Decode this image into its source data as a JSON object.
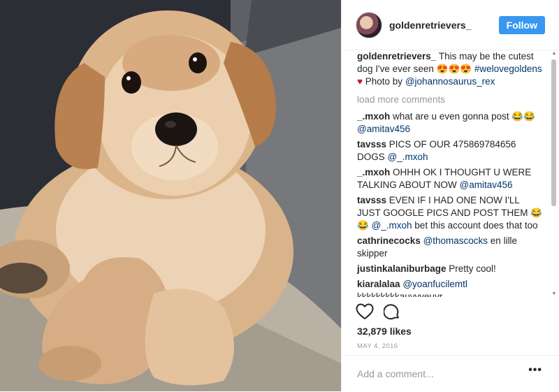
{
  "header": {
    "username": "goldenretrievers_",
    "follow_label": "Follow"
  },
  "caption": {
    "username": "goldenretrievers_",
    "text": " This may be the cutest dog I've ever seen 😍😍😍 ",
    "hashtag": "#welovegoldens",
    "heart": "♥",
    "photo_by": " Photo by ",
    "photo_credit": "@johannosaurus_rex"
  },
  "load_more_label": "load more comments",
  "comments": [
    {
      "user": "_.mxoh",
      "text": " what are u even gonna post 😂😂 ",
      "mention": "@amitav456",
      "after": ""
    },
    {
      "user": "tavsss",
      "text": " PICS OF OUR 475869784656 DOGS ",
      "mention": "@_.mxoh",
      "after": ""
    },
    {
      "user": "_.mxoh",
      "text": " OHHH OK I THOUGHT U WERE TALKING ABOUT NOW ",
      "mention": "@amitav456",
      "after": ""
    },
    {
      "user": "tavsss",
      "text": " EVEN IF I HAD ONE NOW I'LL JUST GOOGLE PICS AND POST THEM 😂😂 ",
      "mention": "@_.mxoh",
      "after": " bet this account does that too"
    },
    {
      "user": "cathrinecocks",
      "text": " ",
      "mention": "@thomascocks",
      "after": " en lille skipper"
    },
    {
      "user": "justinkalaniburbage",
      "text": " Pretty cool!",
      "mention": "",
      "after": ""
    },
    {
      "user": "kiaralalaa",
      "text": " ",
      "mention": "@yoanfucilemtl",
      "after": " kkkkkkkkkauyyyeuyr"
    }
  ],
  "likes_label": "32,879 likes",
  "date_label": "MAY 4, 2016",
  "add_comment_placeholder": "Add a comment...",
  "more_options_label": "•••",
  "icons": {
    "like": "heart-outline-icon",
    "comment": "speech-bubble-icon"
  }
}
